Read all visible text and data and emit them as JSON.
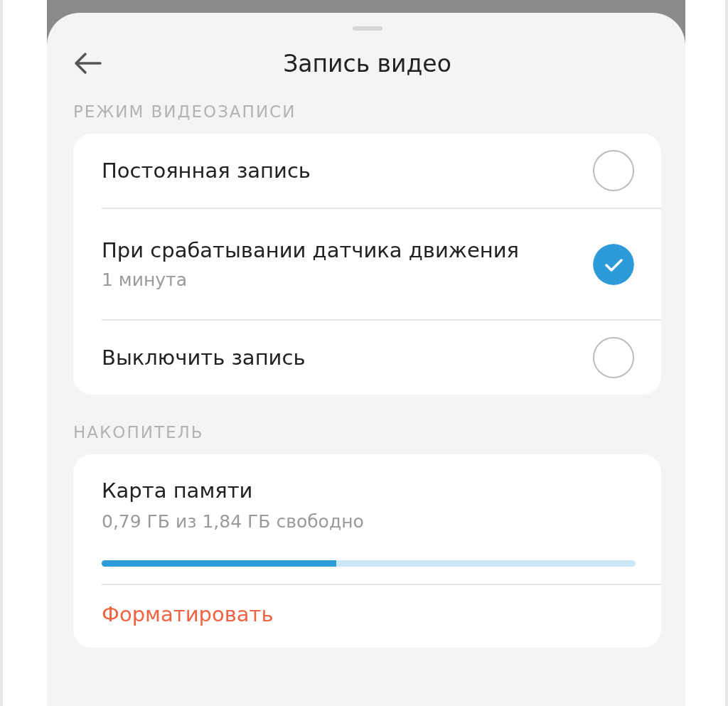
{
  "header": {
    "title": "Запись видео"
  },
  "recording_mode": {
    "heading": "РЕЖИМ ВИДЕОЗАПИСИ",
    "options": [
      {
        "label": "Постоянная запись",
        "selected": false
      },
      {
        "label": "При срабатывании датчика движения",
        "subtitle": "1 минута",
        "selected": true
      },
      {
        "label": "Выключить запись",
        "selected": false
      }
    ]
  },
  "storage": {
    "heading": "НАКОПИТЕЛЬ",
    "title": "Карта памяти",
    "subtitle": "0,79 ГБ из 1,84 ГБ свободно",
    "level": 0.44,
    "action": "Форматировать"
  }
}
